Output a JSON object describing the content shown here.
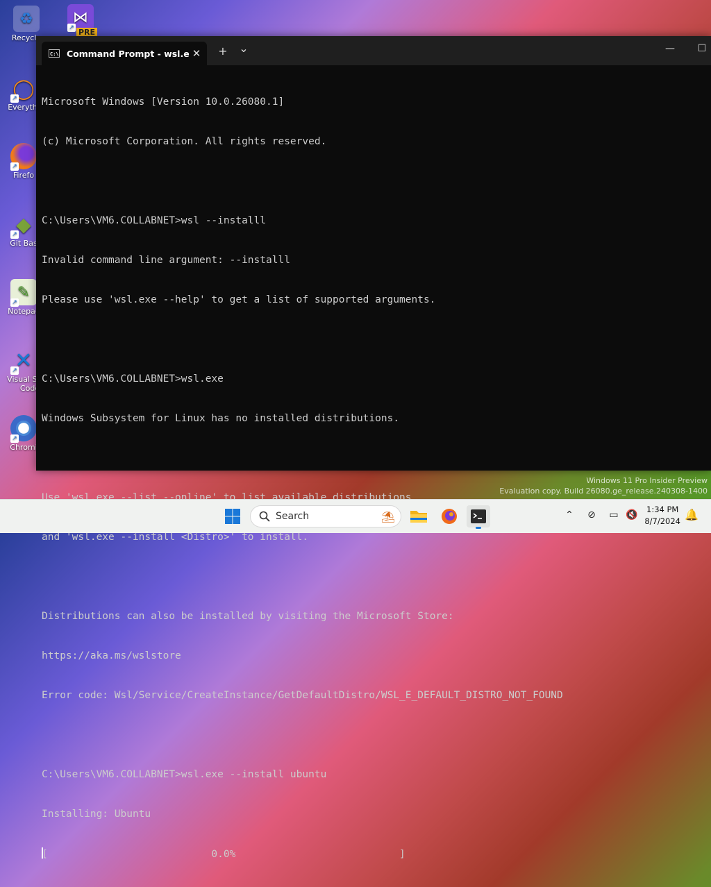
{
  "desktop": {
    "icons": [
      {
        "label": "Recycle",
        "icon": "recycle-bin-icon"
      },
      {
        "label": "PRE",
        "icon": "visual-studio-preview-icon"
      },
      {
        "label": "Everythi",
        "icon": "everything-search-icon"
      },
      {
        "label": "Firefo",
        "icon": "firefox-icon"
      },
      {
        "label": "Git Bas",
        "icon": "git-bash-icon"
      },
      {
        "label": "Notepac",
        "icon": "notepad-plus-plus-icon"
      },
      {
        "label": "Visual St",
        "label2": "Code",
        "icon": "vscode-icon"
      },
      {
        "label": "Chromi",
        "icon": "chromium-icon"
      }
    ]
  },
  "window": {
    "tab_title": "Command Prompt - wsl.exe -",
    "tab_icon_text": "C:\\",
    "close_tab": "✕",
    "new_tab": "+",
    "dropdown": "⌄",
    "minimize": "—",
    "maximize": "☐"
  },
  "console": {
    "lines": [
      "Microsoft Windows [Version 10.0.26080.1]",
      "(c) Microsoft Corporation. All rights reserved.",
      "",
      "C:\\Users\\VM6.COLLABNET>wsl --installl",
      "Invalid command line argument: --installl",
      "Please use 'wsl.exe --help' to get a list of supported arguments.",
      "",
      "C:\\Users\\VM6.COLLABNET>wsl.exe",
      "Windows Subsystem for Linux has no installed distributions.",
      "",
      "Use 'wsl.exe --list --online' to list available distributions",
      "and 'wsl.exe --install <Distro>' to install.",
      "",
      "Distributions can also be installed by visiting the Microsoft Store:",
      "https://aka.ms/wslstore",
      "Error code: Wsl/Service/CreateInstance/GetDefaultDistro/WSL_E_DEFAULT_DISTRO_NOT_FOUND",
      "",
      "C:\\Users\\VM6.COLLABNET>wsl.exe --install ubuntu",
      "Installing: Ubuntu"
    ],
    "progress_line": "[                           0.0%                           ]",
    "progress_percent": 0.0
  },
  "watermark": {
    "line1": "Windows 11 Pro Insider Preview",
    "line2": "Evaluation copy. Build 26080.ge_release.240308-1400"
  },
  "taskbar": {
    "search_placeholder": "Search",
    "time": "1:34 PM",
    "date": "8/7/2024",
    "apps": [
      "start-icon",
      "file-explorer-icon",
      "firefox-icon",
      "terminal-icon"
    ]
  }
}
